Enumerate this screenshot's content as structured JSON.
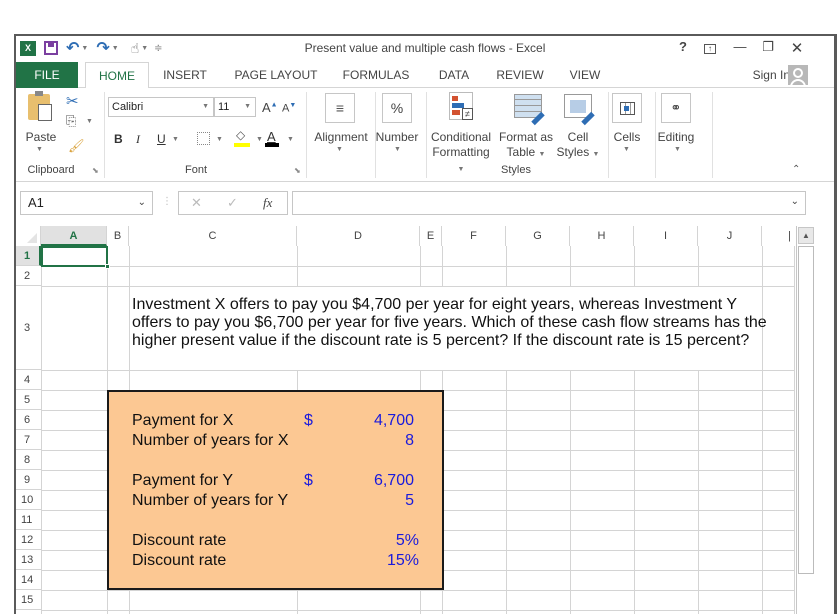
{
  "window": {
    "title": "Present value and multiple cash flows - Excel",
    "help": "?",
    "controls": [
      "ribbon-display",
      "minimize",
      "restore",
      "close"
    ]
  },
  "quick_access": {
    "icons": [
      "excel-logo-icon",
      "save-icon",
      "undo-icon",
      "redo-icon",
      "touch-mode-icon",
      "customize-qat-icon"
    ]
  },
  "tabs": [
    {
      "label": "FILE",
      "type": "file"
    },
    {
      "label": "HOME",
      "active": true
    },
    {
      "label": "INSERT"
    },
    {
      "label": "PAGE LAYOUT"
    },
    {
      "label": "FORMULAS"
    },
    {
      "label": "DATA"
    },
    {
      "label": "REVIEW"
    },
    {
      "label": "VIEW"
    }
  ],
  "account": {
    "sign_in": "Sign In"
  },
  "ribbon": {
    "clipboard": {
      "label": "Clipboard",
      "paste": "Paste"
    },
    "font": {
      "label": "Font",
      "font_name": "Calibri",
      "font_size": "11",
      "bold": "B",
      "italic": "I",
      "underline": "U",
      "fill_color": "#ffff00",
      "font_color": "#000000"
    },
    "alignment": {
      "label": "Alignment"
    },
    "number": {
      "label": "Number",
      "symbol": "%"
    },
    "styles": {
      "label": "Styles",
      "conditional_1": "Conditional",
      "conditional_2": "Formatting",
      "format_table_1": "Format as",
      "format_table_2": "Table",
      "cell_styles_1": "Cell",
      "cell_styles_2": "Styles"
    },
    "cells": {
      "label": "Cells"
    },
    "editing": {
      "label": "Editing"
    }
  },
  "formula_bar": {
    "name_box": "A1",
    "fx": "fx",
    "value": ""
  },
  "sheet": {
    "columns": [
      "A",
      "B",
      "C",
      "D",
      "E",
      "F",
      "G",
      "H",
      "I",
      "J",
      "K"
    ],
    "rows": [
      "1",
      "2",
      "3",
      "4",
      "5",
      "6",
      "7",
      "8",
      "9",
      "10",
      "11",
      "12",
      "13",
      "14",
      "15"
    ],
    "selected_cell": "A1",
    "question": "Investment X offers to pay you $4,700 per year for eight years, whereas Investment Y offers to pay you $6,700 per year for five years. Which of these cash flow streams has the higher present value if the discount rate is 5 percent? If the discount rate is 15 percent?",
    "inputs": [
      {
        "row": "6",
        "label": "Payment for X",
        "currency": "$",
        "value": "4,700"
      },
      {
        "row": "7",
        "label": "Number of years for X",
        "currency": "",
        "value": "8"
      },
      {
        "row": "9",
        "label": "Payment for Y",
        "currency": "$",
        "value": "6,700"
      },
      {
        "row": "10",
        "label": "Number of years for Y",
        "currency": "",
        "value": "5"
      },
      {
        "row": "12",
        "label": "Discount rate",
        "currency": "",
        "value": "5%"
      },
      {
        "row": "13",
        "label": "Discount rate",
        "currency": "",
        "value": "15%"
      }
    ],
    "input_box_fill": "#fcc893",
    "input_value_color": "#1a1adc"
  },
  "colors": {
    "accent": "#217346",
    "gridline": "#d4d4d4"
  }
}
